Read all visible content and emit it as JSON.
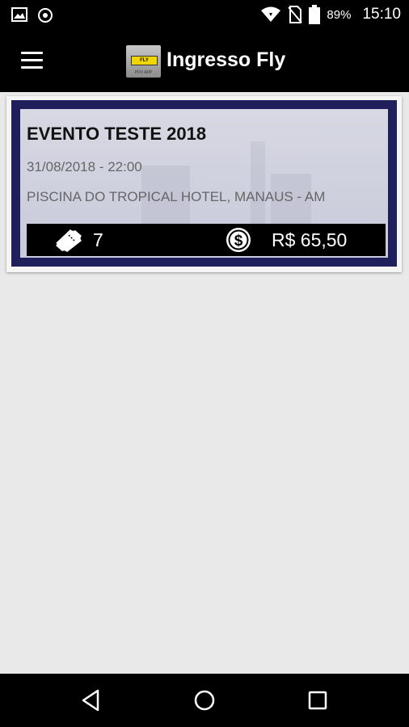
{
  "status_bar": {
    "battery_percent": "89%",
    "time": "15:10"
  },
  "app_bar": {
    "title": "Ingresso Fly"
  },
  "event": {
    "title": "EVENTO TESTE 2018",
    "datetime": "31/08/2018 - 22:00",
    "location": "PISCINA DO TROPICAL HOTEL, MANAUS - AM",
    "tickets": "7",
    "price": "R$ 65,50"
  }
}
